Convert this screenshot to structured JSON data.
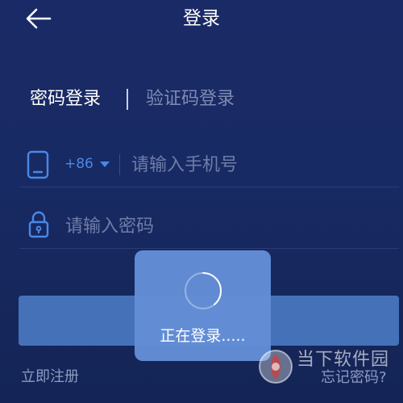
{
  "header": {
    "title": "登录",
    "back_icon": "arrow-left-icon"
  },
  "tabs": {
    "password_login": "密码登录",
    "code_login": "验证码登录"
  },
  "phone": {
    "icon": "phone-icon",
    "country_code": "+86",
    "placeholder": "请输入手机号"
  },
  "password": {
    "icon": "lock-icon",
    "placeholder": "请输入密码"
  },
  "toast": {
    "message": "正在登录....."
  },
  "footer": {
    "register": "立即注册",
    "forgot": "忘记密码?"
  },
  "watermark": {
    "text": "当下软件园"
  },
  "colors": {
    "background": "#1a2a66",
    "accent": "#4a88e6",
    "button": "#4d7fc9",
    "toast": "#648fd6"
  }
}
